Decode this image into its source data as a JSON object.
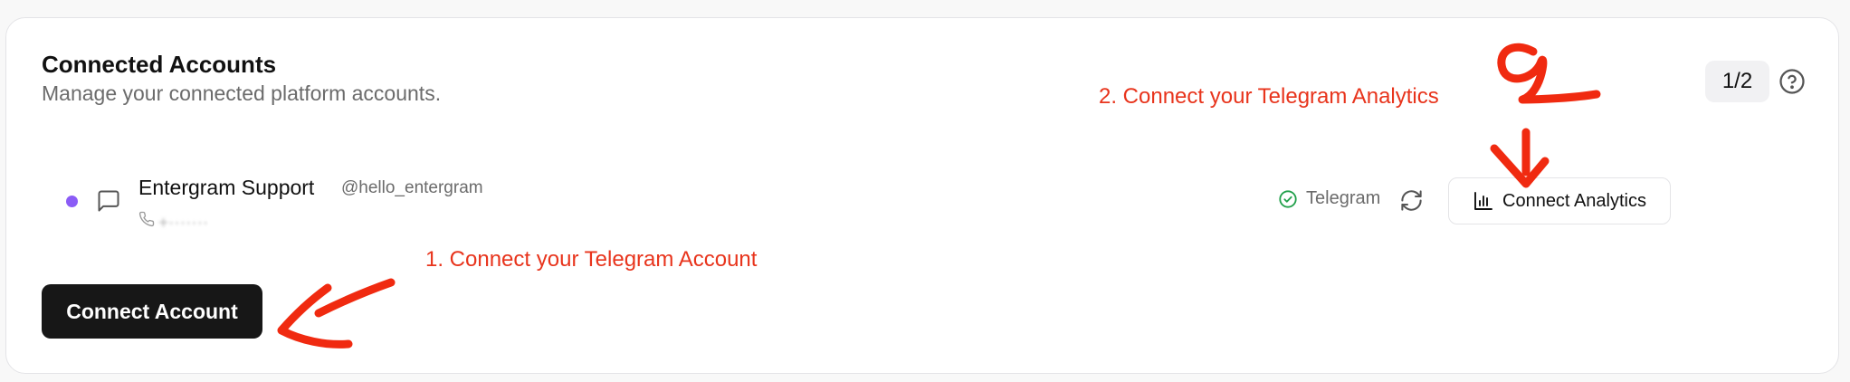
{
  "header": {
    "title": "Connected Accounts",
    "subtitle": "Manage your connected platform accounts.",
    "step": "1/2"
  },
  "icons": {
    "help": "help-circle-icon",
    "chat": "message-square-icon",
    "phone": "phone-icon",
    "check": "check-circle-icon",
    "refresh": "refresh-icon",
    "chart": "bar-chart-icon"
  },
  "account": {
    "name": "Entergram Support",
    "handle": "@hello_entergram",
    "phone": "+·······",
    "platform": "Telegram",
    "status_color": "#8b5cf6"
  },
  "actions": {
    "connect_analytics": "Connect Analytics",
    "connect_account": "Connect Account"
  },
  "annotations": {
    "step1": "1. Connect your Telegram Account",
    "step2": "2. Connect your Telegram Analytics",
    "color": "#e8341c"
  },
  "colors": {
    "primary_button": "#171717",
    "success": "#22a04b"
  }
}
